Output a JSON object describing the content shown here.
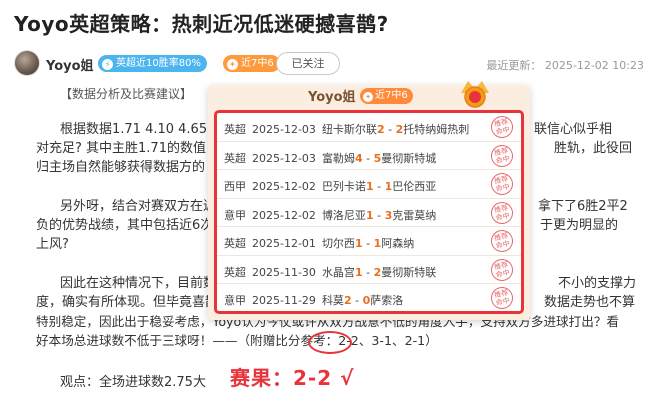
{
  "article": {
    "title": "Yoyo英超策略：热刺近况低迷硬撼喜鹊?"
  },
  "author": {
    "name": "Yoyo姐",
    "rate_badge": "英超近10胜率80%",
    "streak_badge": "近7中6",
    "follow_label": "已关注",
    "updated": "最近更新：   2025-12-02 10:23"
  },
  "content": {
    "heading": "【数据分析及比赛建议】",
    "p1_l1": "根据数据1.71 4.10 4.65的",
    "p1_l1_r": "联信心似乎相",
    "p1_l2": "对充足? 其中主胜1.71的数值",
    "p1_l2_r": "胜轨，此役回",
    "p1_l3": "归主场自然能够获得数据方的",
    "p2_l1": "另外呀，结合对赛双方在近",
    "p2_l1_r": "拿下了6胜2平2",
    "p2_l2": "负的优势战绩，其中包括近6次",
    "p2_l2_r": "于更为明显的",
    "p2_l3": "上风?",
    "p3_l1": "因此在这种情况下，目前数",
    "p3_l1_r": "不小的支撑力",
    "p3_l2": "度，确实有所体现。但毕竟喜鹊",
    "p3_l2_r": "数据走势也不算",
    "p3_l3": "特别稳定，因此出于稳妥考虑，Yoyo认为今仗或许从双方战意不低的角度入手，支持双方多进球打出？看",
    "p3_l4": "好本场总进球数不低于三球呀！——（附赠比分参考：2-2、3-1、2-1）",
    "view": "观点：全场进球数2.75大"
  },
  "result": {
    "label": "赛果：2-2 √"
  },
  "popup": {
    "name": "Yoyo姐",
    "streak": "近7中6",
    "matches": [
      {
        "league": "英超",
        "date": "2025-12-03",
        "home": "纽卡斯尔联",
        "home_score": "2",
        "away_score": "2",
        "away": "托特纳姆热刺",
        "stamp": "推荐 命中"
      },
      {
        "league": "英超",
        "date": "2025-12-03",
        "home": "富勒姆",
        "home_score": "4",
        "away_score": "5",
        "away": "曼彻斯特城",
        "stamp": "推荐 命中"
      },
      {
        "league": "西甲",
        "date": "2025-12-02",
        "home": "巴列卡诺",
        "home_score": "1",
        "away_score": "1",
        "away": "巴伦西亚",
        "stamp": "推荐 命中"
      },
      {
        "league": "意甲",
        "date": "2025-12-02",
        "home": "博洛尼亚",
        "home_score": "1",
        "away_score": "3",
        "away": "克雷莫纳",
        "stamp": "推荐 命中"
      },
      {
        "league": "英超",
        "date": "2025-12-01",
        "home": "切尔西",
        "home_score": "1",
        "away_score": "1",
        "away": "阿森纳",
        "stamp": "推荐 命中"
      },
      {
        "league": "英超",
        "date": "2025-11-30",
        "home": "水晶宫",
        "home_score": "1",
        "away_score": "2",
        "away": "曼彻斯特联",
        "stamp": "推荐 命中"
      },
      {
        "league": "意甲",
        "date": "2025-11-29",
        "home": "科莫",
        "home_score": "2",
        "away_score": "0",
        "away": "萨索洛",
        "stamp": "推荐 命中"
      }
    ]
  },
  "colors": {
    "accent_red": "#e8333a",
    "score_orange": "#e8701e",
    "rate_blue": "#4cb5f0",
    "streak_orange": "#ff9a3c"
  }
}
